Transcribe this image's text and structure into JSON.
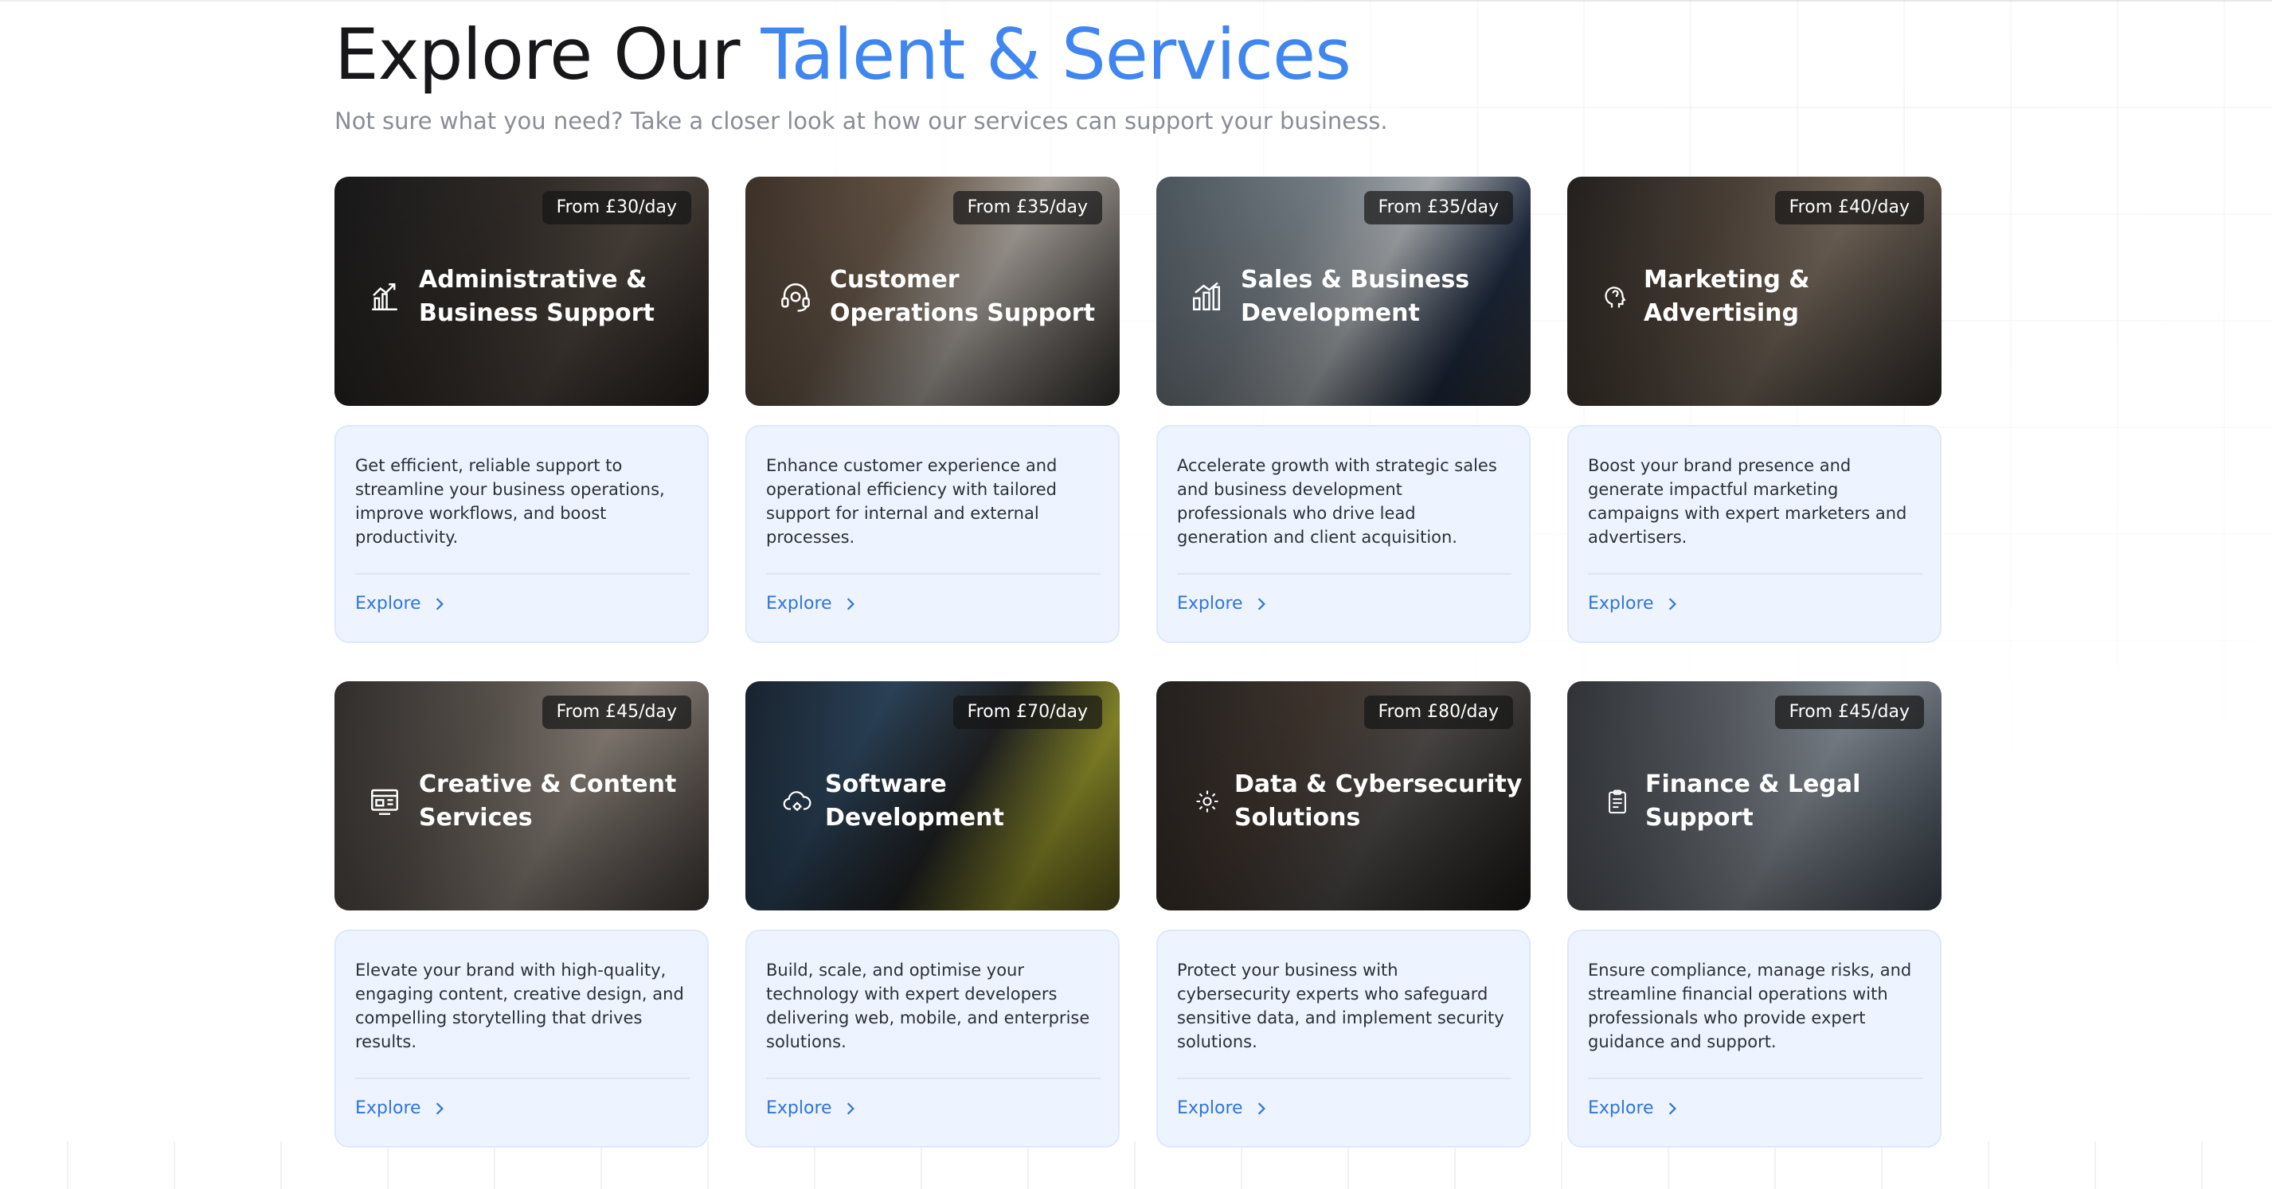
{
  "header": {
    "title_prefix": "Explore Our ",
    "title_accent": "Talent & Services",
    "subtitle": "Not sure what you need? Take a closer look at how our services can support your business."
  },
  "colors": {
    "accent": "#3f86f0",
    "link": "#2f74dc",
    "card_body_bg": "#eef4ff",
    "heading": "#17171a",
    "subtitle": "#8a8d96"
  },
  "services": [
    {
      "price": "From £30/day",
      "title": "Administrative & Business Support",
      "icon": "chart-growth-icon",
      "description": "Get efficient, reliable support to streamline your business operations, improve workflows, and boost productivity.",
      "link_label": "Explore"
    },
    {
      "price": "From £35/day",
      "title": "Customer Operations Support",
      "icon": "headset-support-icon",
      "description": "Enhance customer experience and operational efficiency with tailored support for internal and external processes.",
      "link_label": "Explore"
    },
    {
      "price": "From £35/day",
      "title": "Sales & Business Development",
      "icon": "bar-chart-icon",
      "description": "Accelerate growth with strategic sales and business development professionals who drive lead generation and client acquisition.",
      "link_label": "Explore"
    },
    {
      "price": "From £40/day",
      "title": "Marketing & Advertising",
      "icon": "marketing-brain-icon",
      "description": "Boost your brand presence and generate impactful marketing campaigns with expert marketers and advertisers.",
      "link_label": "Explore"
    },
    {
      "price": "From £45/day",
      "title": "Creative & Content Services",
      "icon": "creative-layout-icon",
      "description": "Elevate your brand with high-quality, engaging content, creative design, and compelling storytelling that drives results.",
      "link_label": "Explore"
    },
    {
      "price": "From £70/day",
      "title": "Software Development",
      "icon": "cloud-gear-icon",
      "description": "Build, scale, and optimise your technology with expert developers delivering web, mobile, and enterprise solutions.",
      "link_label": "Explore"
    },
    {
      "price": "From £80/day",
      "title": "Data & Cybersecurity Solutions",
      "icon": "data-security-icon",
      "description": "Protect your business with cybersecurity experts who safeguard sensitive data, and implement security solutions.",
      "link_label": "Explore"
    },
    {
      "price": "From £45/day",
      "title": "Finance & Legal Support",
      "icon": "clipboard-document-icon",
      "description": "Ensure compliance, manage risks, and streamline financial operations with professionals who provide expert guidance and support.",
      "link_label": "Explore"
    }
  ]
}
